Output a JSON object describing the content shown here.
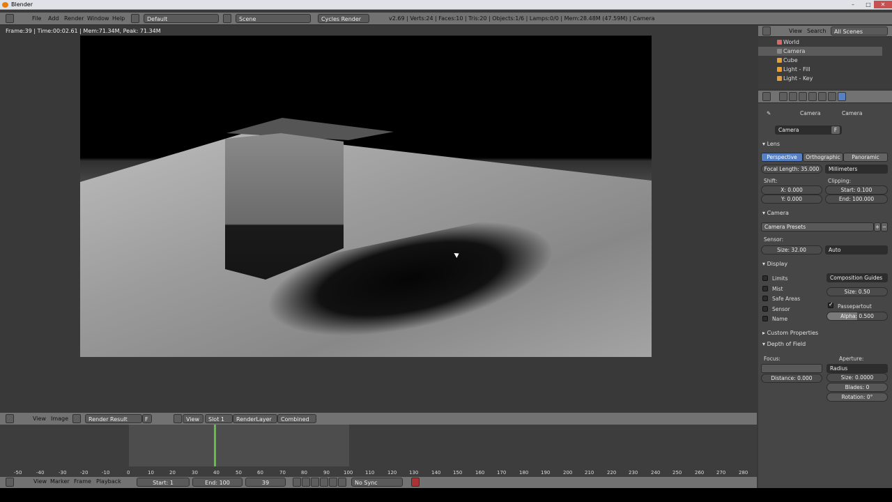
{
  "window": {
    "title": "Blender"
  },
  "top_header": {
    "menus": [
      "File",
      "Add",
      "Render",
      "Window",
      "Help"
    ],
    "layout": "Default",
    "scene": "Scene",
    "engine": "Cycles Render",
    "info": "v2.69 | Verts:24 | Faces:10 | Tris:20 | Objects:1/6 | Lamps:0/0 | Mem:28.48M (47.59M) | Camera"
  },
  "image_editor": {
    "render_info": "Frame:39 | Time:00:02.61 | Mem:71.34M, Peak: 71.34M",
    "menus": [
      "View",
      "Image"
    ],
    "image": "Render Result",
    "fake_user": "F",
    "view": "View",
    "slot": "Slot 1",
    "layer": "RenderLayer",
    "pass": "Combined"
  },
  "outliner": {
    "menus": [
      "View",
      "Search"
    ],
    "filter": "All Scenes",
    "items": [
      {
        "label": "World",
        "color": "#d66"
      },
      {
        "label": "Camera",
        "color": "#888"
      },
      {
        "label": "Cube",
        "color": "#e8a030"
      },
      {
        "label": "Light - Fill",
        "color": "#e8a030"
      },
      {
        "label": "Light - Key",
        "color": "#e8a030"
      }
    ]
  },
  "properties": {
    "breadcrumb": [
      "Camera",
      "Camera"
    ],
    "datablock": "Camera",
    "fake_user": "F",
    "lens": {
      "title": "Lens",
      "types": [
        "Perspective",
        "Orthographic",
        "Panoramic"
      ],
      "active_type": "Perspective",
      "focal_length": "Focal Length: 35.000",
      "units": "Millimeters",
      "shift_label": "Shift:",
      "shift_x": "X: 0.000",
      "shift_y": "Y: 0.000",
      "clipping_label": "Clipping:",
      "clip_start": "Start: 0.100",
      "clip_end": "End: 100.000"
    },
    "camera": {
      "title": "Camera",
      "presets": "Camera Presets",
      "sensor_label": "Sensor:",
      "sensor_size": "Size: 32.00",
      "sensor_fit": "Auto"
    },
    "display": {
      "title": "Display",
      "checks": [
        {
          "label": "Limits",
          "checked": false
        },
        {
          "label": "Mist",
          "checked": false
        },
        {
          "label": "Safe Areas",
          "checked": false
        },
        {
          "label": "Sensor",
          "checked": false
        },
        {
          "label": "Name",
          "checked": false
        }
      ],
      "guides": "Composition Guides",
      "size": "Size: 0.50",
      "passepartout": "Passepartout",
      "alpha": "Alpha: 0.500"
    },
    "custom_props": "Custom Properties",
    "dof": {
      "title": "Depth of Field",
      "focus_label": "Focus:",
      "distance": "Distance: 0.000",
      "aperture_label": "Aperture:",
      "aperture_type": "Radius",
      "size": "Size: 0.0000",
      "blades": "Blades: 0",
      "rotation": "Rotation: 0°"
    }
  },
  "timeline": {
    "ticks": [
      "-50",
      "-40",
      "-30",
      "-20",
      "-10",
      "0",
      "10",
      "20",
      "30",
      "40",
      "50",
      "60",
      "70",
      "80",
      "90",
      "100",
      "110",
      "120",
      "130",
      "140",
      "150",
      "160",
      "170",
      "180",
      "190",
      "200",
      "210",
      "220",
      "230",
      "240",
      "250",
      "260",
      "270",
      "280"
    ],
    "menus": [
      "View",
      "Marker",
      "Frame",
      "Playback"
    ],
    "start": "Start: 1",
    "end": "End: 100",
    "current": "39",
    "sync": "No Sync"
  }
}
